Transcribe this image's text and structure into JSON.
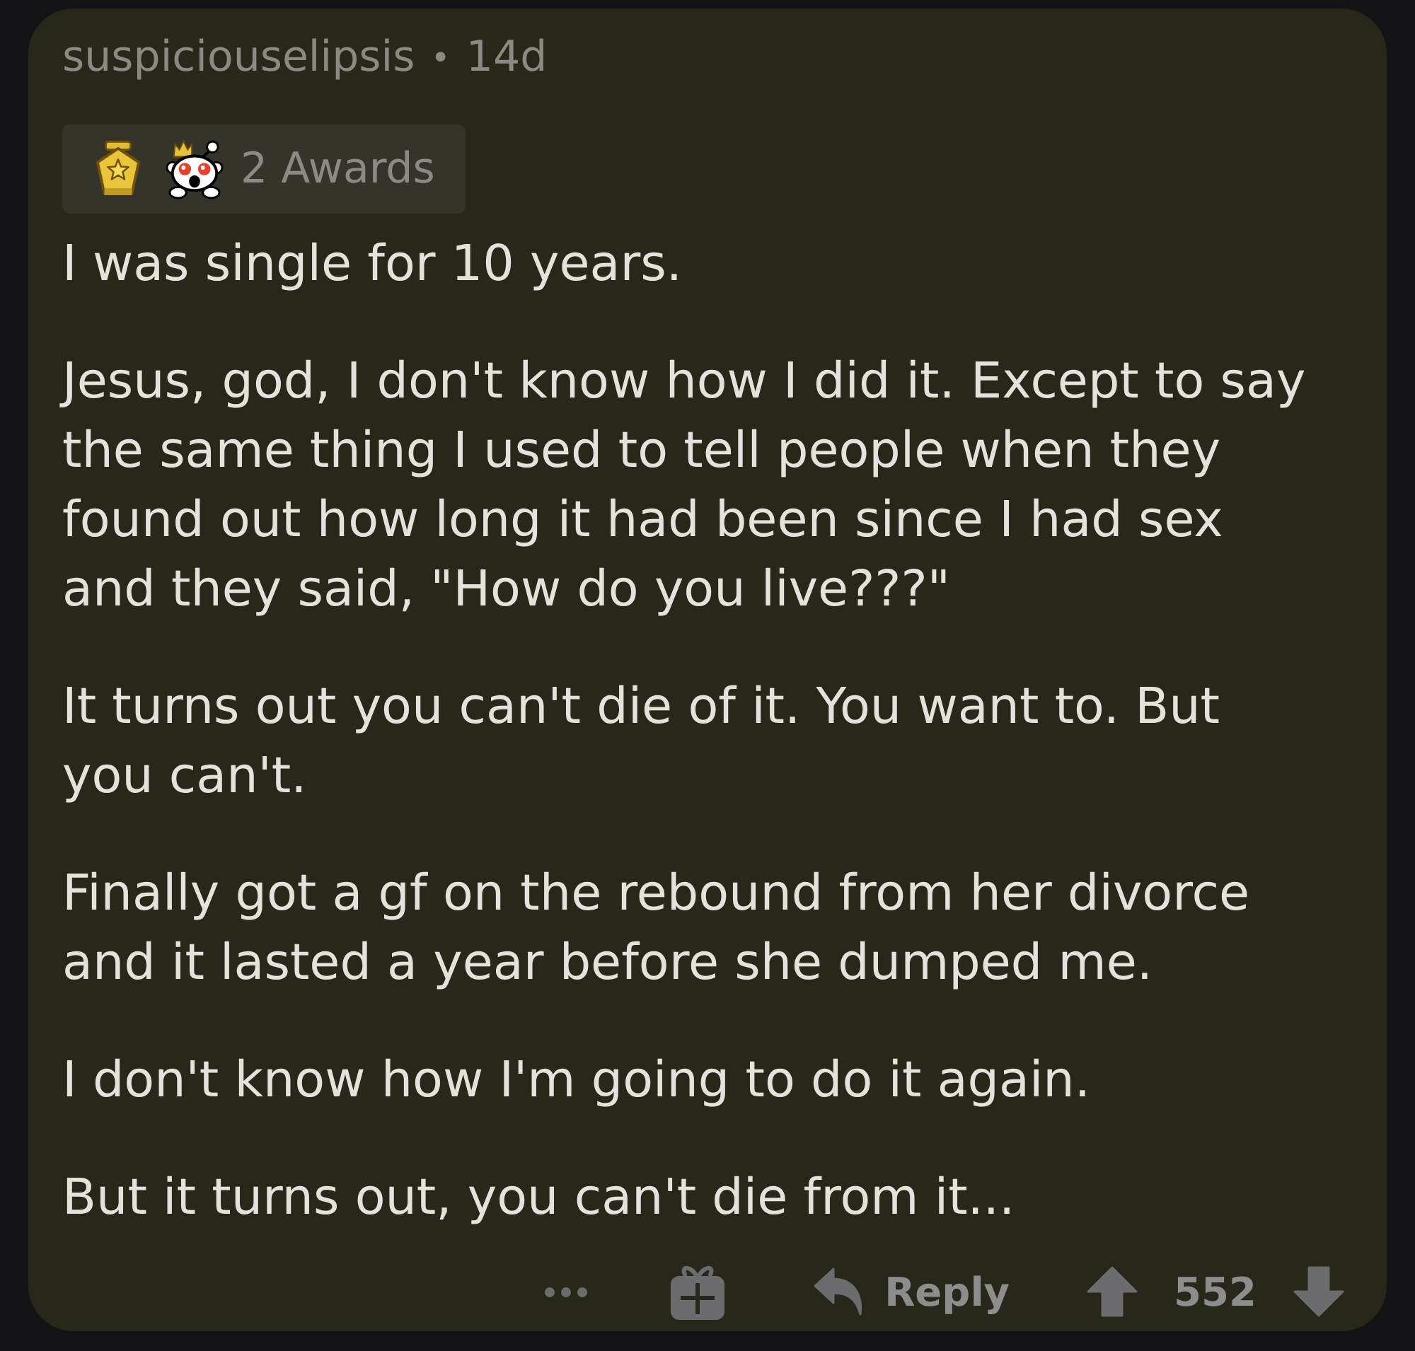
{
  "comment": {
    "author": "suspiciouselipsis",
    "separator": "•",
    "age": "14d"
  },
  "awards": {
    "label": "2 Awards"
  },
  "body": {
    "paragraphs": [
      "I was single for 10 years.",
      "Jesus, god, I don't know how I did it. Except to say the same thing I used to tell people when they found out how long it had been since I had sex and they said, \"How do you live???\"",
      "It turns out you can't die of it. You want to. But you can't.",
      "Finally got a gf on the rebound from her divorce and it lasted a year before she dumped me.",
      "I don't know how I'm going to do it again.",
      "But it turns out, you can't die from it..."
    ]
  },
  "actions": {
    "reply": "Reply",
    "score": "552"
  }
}
